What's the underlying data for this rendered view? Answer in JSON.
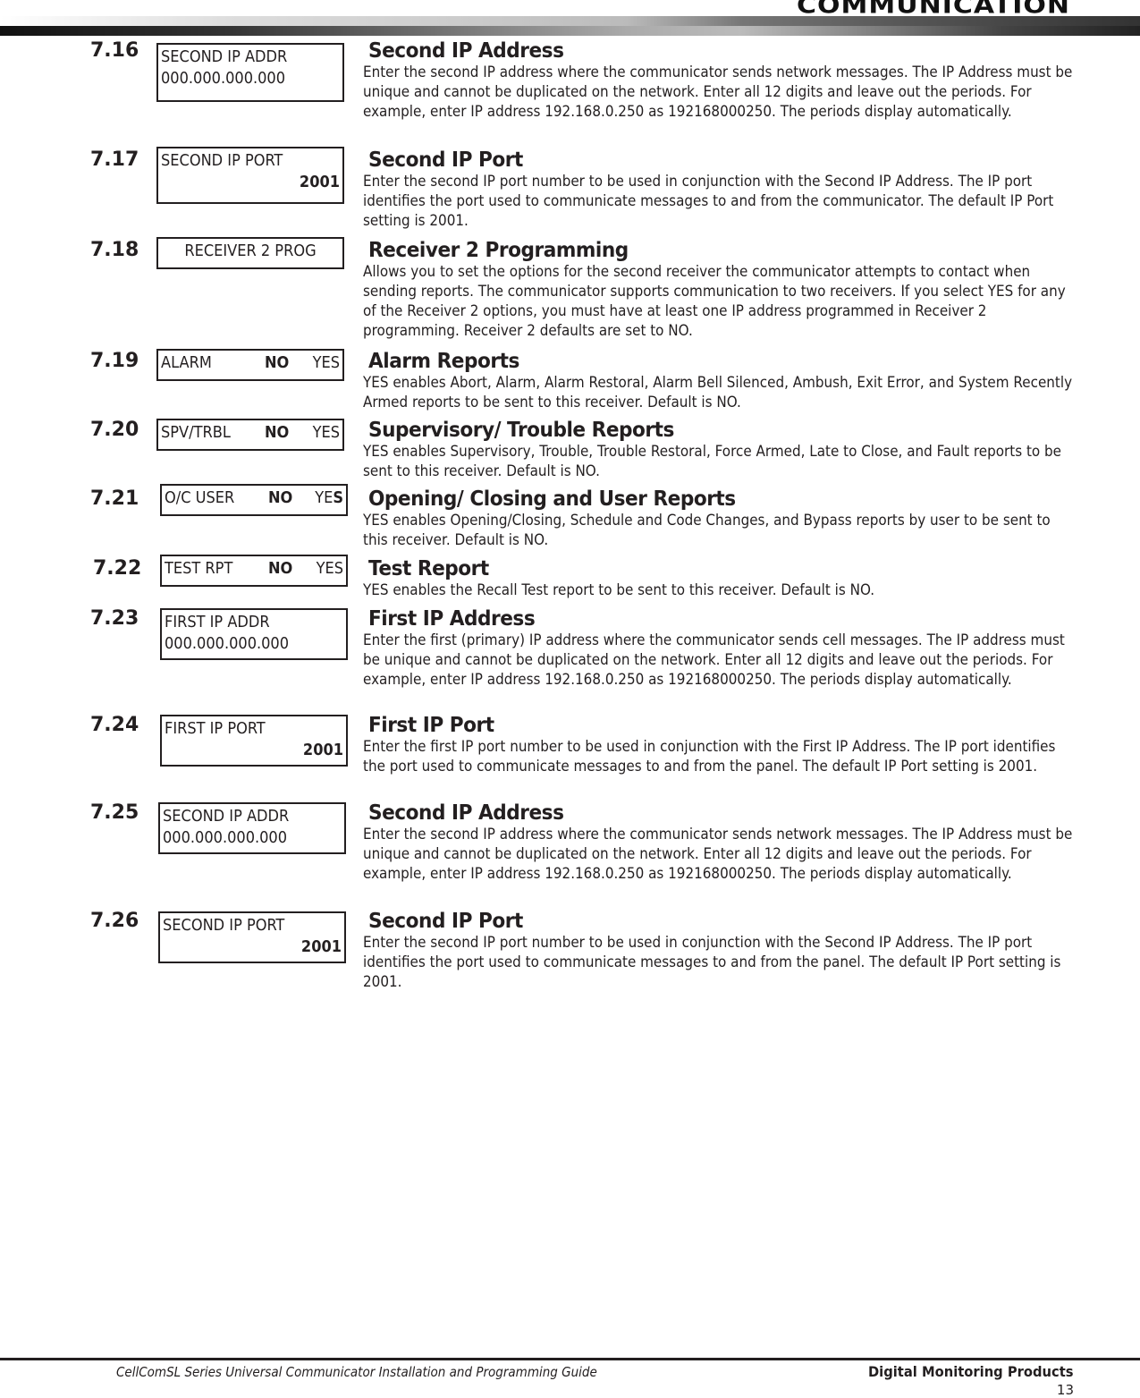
{
  "header": {
    "chapter_title": "COMMUNICATION"
  },
  "sections": [
    {
      "number": "7.16",
      "display": {
        "line1": "SECOND IP ADDR",
        "line2": "000.000.000.000"
      },
      "title": "Second IP Address",
      "body": "Enter the second IP address where the communicator sends network messages. The IP Address must be unique and cannot be duplicated on the network. Enter all 12 digits and leave out the periods. For example, enter IP address 192.168.0.250 as 192168000250. The periods display automatically."
    },
    {
      "number": "7.17",
      "display": {
        "line1": "SECOND IP PORT",
        "line2": "2001"
      },
      "title": "Second IP Port",
      "body": "Enter the second IP port number to be used in conjunction with the Second IP Address. The IP port identifies the port used to communicate messages to and from the communicator. The default IP Port setting is 2001."
    },
    {
      "number": "7.18",
      "display": {
        "line1": "RECEIVER 2 PROG"
      },
      "title": "Receiver 2 Programming",
      "body": "Allows you to set the options for the second receiver the communicator attempts to contact when sending reports. The communicator supports communication to two receivers. If you select YES for any of the Receiver 2 options, you must have at least one IP address programmed in Receiver 2 programming. Receiver 2 defaults are set to NO."
    },
    {
      "number": "7.19",
      "display": {
        "label": "ALARM",
        "no": "NO",
        "yes": "YES"
      },
      "title": "Alarm Reports",
      "body": "YES enables Abort, Alarm, Alarm Restoral, Alarm Bell Silenced, Ambush, Exit Error, and System Recently Armed reports to be sent to this receiver. Default is NO."
    },
    {
      "number": "7.20",
      "display": {
        "label": "SPV/TRBL",
        "no": "NO",
        "yes": "YES"
      },
      "title": "Supervisory/ Trouble Reports",
      "body": "YES enables Supervisory, Trouble, Trouble Restoral, Force Armed, Late to Close, and Fault reports to be sent to this receiver. Default is NO."
    },
    {
      "number": "7.21",
      "display": {
        "label": "O/C USER",
        "no": "NO",
        "yes_prefix": "YE",
        "yes_suffix": "S"
      },
      "title": "Opening/ Closing and User Reports",
      "body": "YES enables Opening/Closing, Schedule and Code Changes, and Bypass reports by user to be sent to this receiver. Default is NO."
    },
    {
      "number": "7.22",
      "display": {
        "label": "TEST RPT",
        "no": "NO",
        "yes": "YES"
      },
      "title": "Test Report",
      "body": "YES enables the Recall Test report to be sent to this receiver. Default is NO."
    },
    {
      "number": "7.23",
      "display": {
        "line1": "FIRST IP ADDR",
        "line2": "000.000.000.000"
      },
      "title": "First IP Address",
      "body": "Enter the first (primary) IP address where the communicator sends cell messages. The IP address must be unique and cannot be duplicated on the network. Enter all 12 digits and leave out the periods. For example, enter IP address 192.168.0.250 as 192168000250. The periods display automatically."
    },
    {
      "number": "7.24",
      "display": {
        "line1": "FIRST IP PORT",
        "line2": "2001"
      },
      "title": "First IP Port",
      "body": "Enter the first IP port number to be used in conjunction with the First IP Address. The IP port identifies the port used to communicate messages to and from the panel. The default IP Port setting is 2001."
    },
    {
      "number": "7.25",
      "display": {
        "line1": "SECOND IP ADDR",
        "line2": "000.000.000.000"
      },
      "title": "Second IP Address",
      "body": "Enter the second IP address where the communicator sends network messages. The IP Address must be unique and cannot be duplicated on the network. Enter all 12 digits and leave out the periods. For example, enter IP address 192.168.0.250 as 192168000250. The periods display automatically."
    },
    {
      "number": "7.26",
      "display": {
        "line1": "SECOND IP PORT",
        "line2": "2001"
      },
      "title": "Second IP Port",
      "body": "Enter the second IP port number to be used in conjunction with the Second IP Address. The IP port identifies the port used to communicate messages to and from the panel. The default IP Port setting is 2001."
    }
  ],
  "footer": {
    "guide_title": "CellComSL Series Universal Communicator Installation and Programming Guide",
    "company": "Digital Monitoring Products",
    "page_number": "13"
  }
}
